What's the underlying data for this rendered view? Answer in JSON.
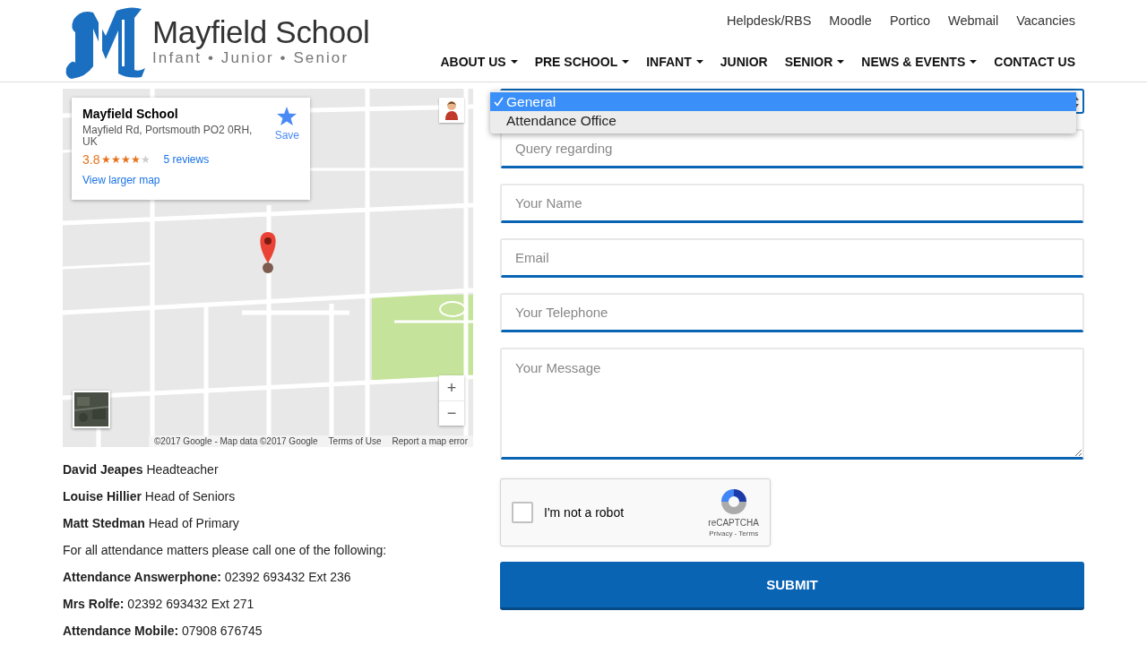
{
  "header": {
    "logo": {
      "title": "Mayfield School",
      "subtitle": "Infant • Junior • Senior"
    },
    "top_links": [
      "Helpdesk/RBS",
      "Moodle",
      "Portico",
      "Webmail",
      "Vacancies"
    ],
    "nav": [
      {
        "label": "ABOUT US",
        "dropdown": true
      },
      {
        "label": "PRE SCHOOL",
        "dropdown": true
      },
      {
        "label": "INFANT",
        "dropdown": true
      },
      {
        "label": "JUNIOR",
        "dropdown": false
      },
      {
        "label": "SENIOR",
        "dropdown": true
      },
      {
        "label": "NEWS & EVENTS",
        "dropdown": true
      },
      {
        "label": "CONTACT US",
        "dropdown": false
      }
    ]
  },
  "map": {
    "card": {
      "title": "Mayfield School",
      "address": "Mayfield Rd, Portsmouth PO2 0RH, UK",
      "rating": "3.8",
      "stars": 4,
      "reviews": "5 reviews",
      "save": "Save",
      "larger_map": "View larger map"
    },
    "zoom_in": "+",
    "zoom_out": "−",
    "attribution": [
      "©2017 Google - Map data ©2017 Google",
      "Terms of Use",
      "Report a map error"
    ]
  },
  "contacts": [
    "**David Jeapes** Headteacher",
    "**Louise Hillier** Head of Seniors",
    "**Matt Stedman** Head of Primary",
    "For all attendance matters please call one of the following:",
    "**Attendance Answerphone:** 02392 693432 Ext 236",
    "**Mrs Rolfe:** 02392 693432 Ext 271",
    "**Attendance Mobile:** 07908 676745"
  ],
  "form": {
    "select": {
      "expanded": true,
      "options": [
        {
          "label": "General",
          "selected": true
        },
        {
          "label": "Attendance Office",
          "selected": false
        }
      ]
    },
    "fields": [
      {
        "kind": "input",
        "placeholder": "Query regarding"
      },
      {
        "kind": "input",
        "placeholder": "Your Name"
      },
      {
        "kind": "input",
        "placeholder": "Email"
      },
      {
        "kind": "input",
        "placeholder": "Your Telephone"
      },
      {
        "kind": "textarea",
        "placeholder": "Your Message"
      }
    ],
    "captcha": {
      "label": "I'm not a robot",
      "checked": false,
      "brand": "reCAPTCHA",
      "links": "Privacy - Terms"
    },
    "submit": "SUBMIT"
  }
}
